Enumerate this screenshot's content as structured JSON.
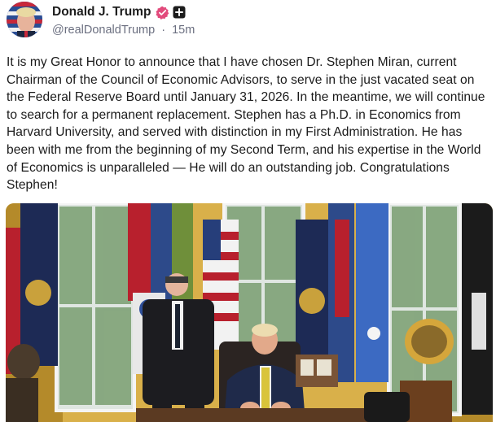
{
  "post": {
    "author_name": "Donald J. Trump",
    "handle": "@realDonaldTrump",
    "separator": "·",
    "time": "15m",
    "text": "It is my Great Honor to announce that I have chosen Dr. Stephen Miran, current Chairman of the Council of Economic Advisors, to serve in the just vacated seat on the Federal Reserve Board until January 31, 2026. In the meantime, we will continue to search for a permanent replacement. Stephen has a Ph.D. in Economics from Harvard University, and served with distinction in my First Administration. He has been with me from the beginning of my Second Term, and his expertise in the World of Economics is unparalleled — He will do an outstanding job. Congratulations Stephen!",
    "verified_icon": "verified-badge-icon",
    "extra_icon": "plus-square-icon"
  },
  "colors": {
    "verified": "#e24a7c",
    "handle": "#6b6f80",
    "text": "#1a1a1a"
  }
}
